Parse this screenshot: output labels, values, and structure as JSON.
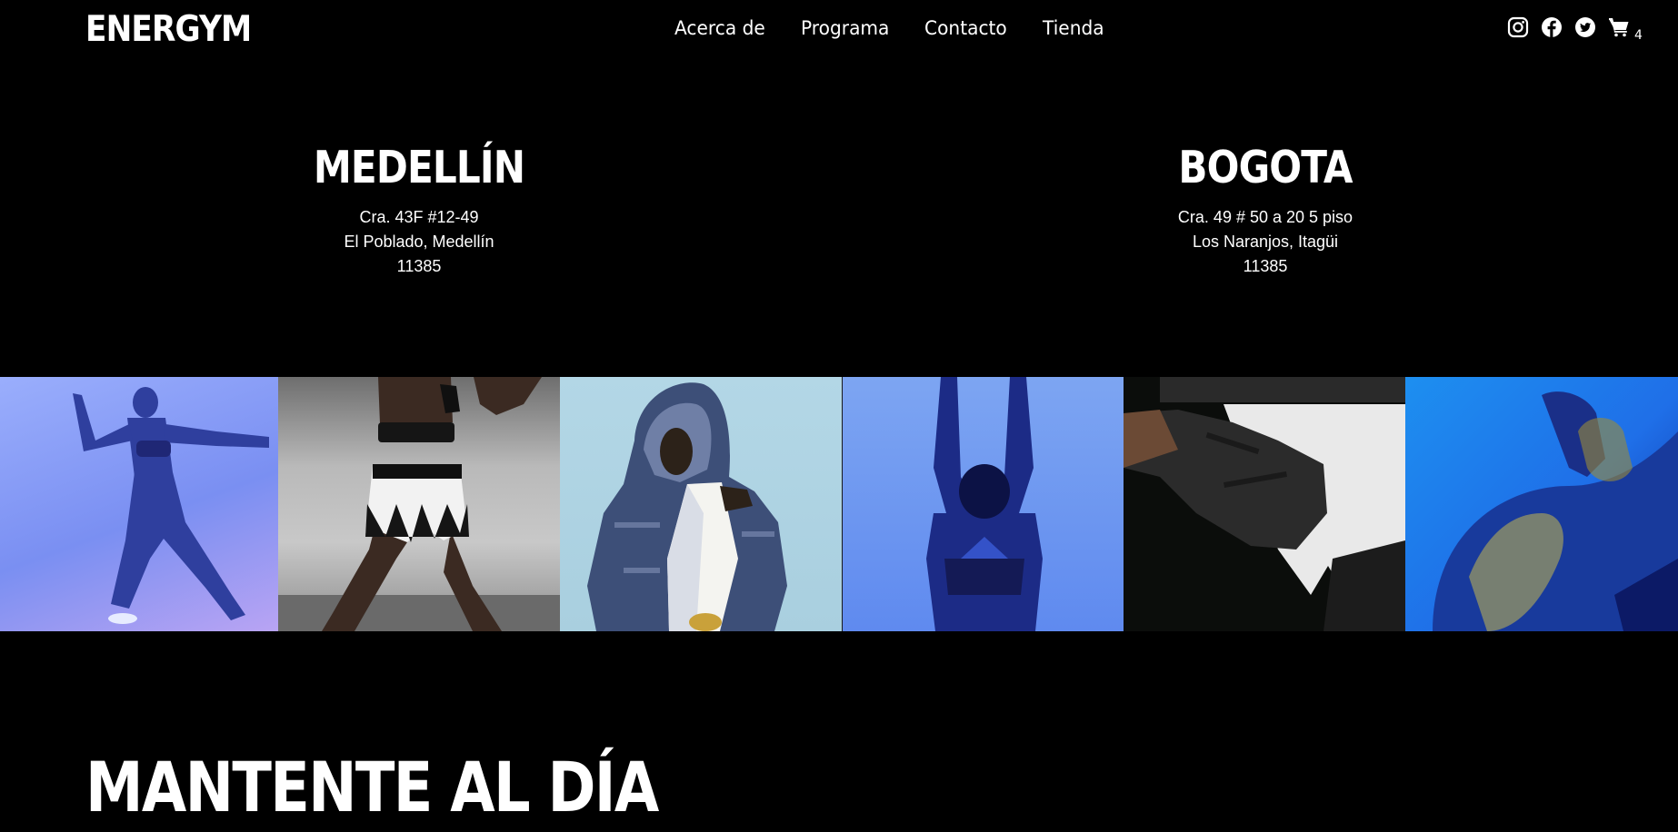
{
  "header": {
    "logo": "ENERGYM",
    "nav": [
      "Acerca de",
      "Programa",
      "Contacto",
      "Tienda"
    ],
    "social_icons": [
      "instagram-icon",
      "facebook-icon",
      "twitter-icon"
    ],
    "cart_icon": "cart-icon",
    "cart_count": "4"
  },
  "locations": [
    {
      "city": "MEDELLÍN",
      "line1": "Cra. 43F #12-49",
      "line2": "El Poblado, Medellín",
      "line3": "11385"
    },
    {
      "city": "BOGOTA",
      "line1": "Cra. 49 # 50 a 20 5 piso",
      "line2": "Los Naranjos, Itagüi",
      "line3": "11385"
    }
  ],
  "gallery": {
    "images": [
      "athlete-running-photo",
      "boxer-stance-photo",
      "hooded-athlete-photo",
      "arms-raised-photo",
      "wrapped-fist-photo",
      "shoulder-closeup-photo"
    ]
  },
  "section": {
    "heading": "MANTENTE AL DÍA"
  },
  "colors": {
    "background": "#000000",
    "text": "#ffffff"
  }
}
